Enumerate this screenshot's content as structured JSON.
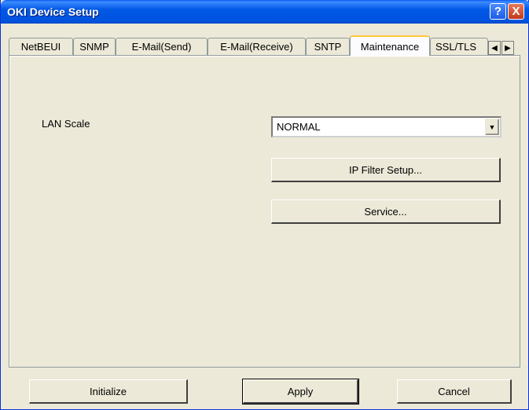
{
  "window": {
    "title": "OKI Device Setup"
  },
  "titlebar": {
    "help": "?",
    "close": "X"
  },
  "tabs": [
    {
      "label": "NetBEUI"
    },
    {
      "label": "SNMP"
    },
    {
      "label": "E-Mail(Send)"
    },
    {
      "label": "E-Mail(Receive)"
    },
    {
      "label": "SNTP"
    },
    {
      "label": "Maintenance",
      "active": true
    },
    {
      "label": "SSL/TLS"
    }
  ],
  "tab_scroll": {
    "left": "◀",
    "right": "▶"
  },
  "maintenance": {
    "lan_scale_label": "LAN Scale",
    "lan_scale_value": "NORMAL",
    "combo_arrow": "▼",
    "ip_filter_button": "IP Filter Setup...",
    "service_button": "Service..."
  },
  "footer": {
    "initialize": "Initialize",
    "apply": "Apply",
    "cancel": "Cancel"
  }
}
